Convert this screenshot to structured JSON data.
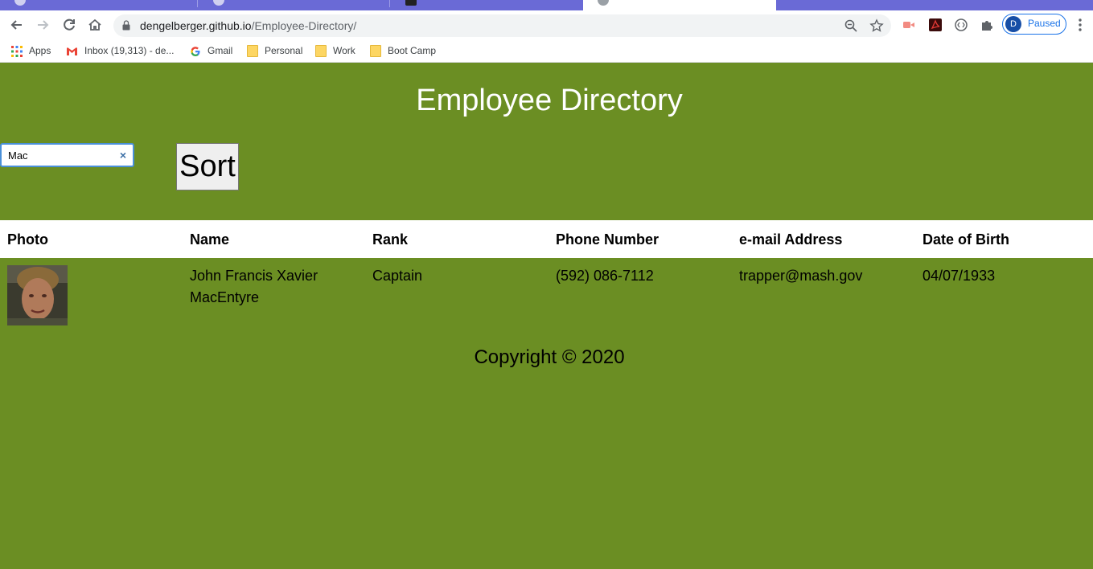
{
  "browser": {
    "tabs": [
      {
        "title": "",
        "active": false
      },
      {
        "title": "",
        "active": false
      },
      {
        "title": "",
        "active": false
      },
      {
        "title": "",
        "active": true
      },
      {
        "title": "",
        "active": false
      }
    ],
    "url_host": "dengelberger.github.io",
    "url_path": "/Employee-Directory/",
    "profile_initial": "D",
    "profile_status": "Paused",
    "bookmarks": [
      {
        "label": "Apps",
        "icon": "apps-grid-icon"
      },
      {
        "label": "Inbox (19,313) - de...",
        "icon": "gmail-icon"
      },
      {
        "label": "Gmail",
        "icon": "google-icon"
      },
      {
        "label": "Personal",
        "icon": "folder-icon"
      },
      {
        "label": "Work",
        "icon": "folder-icon"
      },
      {
        "label": "Boot Camp",
        "icon": "folder-icon"
      }
    ]
  },
  "page": {
    "title": "Employee Directory",
    "search": {
      "value": "Mac",
      "placeholder": ""
    },
    "sort_label": "Sort",
    "columns": [
      "Photo",
      "Name",
      "Rank",
      "Phone Number",
      "e-mail Address",
      "Date of Birth"
    ],
    "rows": [
      {
        "photo": "employee-photo",
        "name": "John Francis Xavier MacEntyre",
        "rank": "Captain",
        "phone": "(592) 086-7112",
        "email": "trapper@mash.gov",
        "dob": "04/07/1933"
      }
    ],
    "footer": "Copyright © 2020"
  },
  "colors": {
    "page_background": "#6b8e23",
    "tab_strip": "#6a6ad6",
    "profile_accent": "#1a73e8"
  }
}
